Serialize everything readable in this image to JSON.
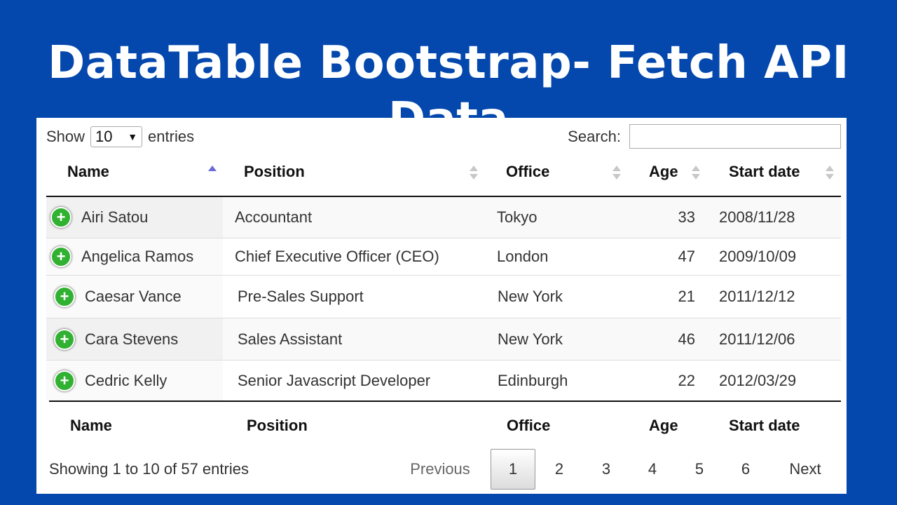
{
  "banner": {
    "title": "DataTable Bootstrap- Fetch API Data"
  },
  "controls": {
    "show_label": "Show",
    "entries_label": "entries",
    "page_length": "10",
    "search_label": "Search:",
    "search_value": ""
  },
  "table": {
    "columns": [
      "Name",
      "Position",
      "Office",
      "Age",
      "Start date"
    ],
    "sorted_column": "Name",
    "sort_direction": "ascending",
    "rows": [
      {
        "name": "Airi Satou",
        "position": "Accountant",
        "office": "Tokyo",
        "age": "33",
        "start_date": "2008/11/28"
      },
      {
        "name": "Angelica Ramos",
        "position": "Chief Executive Officer (CEO)",
        "office": "London",
        "age": "47",
        "start_date": "2009/10/09"
      },
      {
        "name": "Caesar Vance",
        "position": "Pre-Sales Support",
        "office": "New York",
        "age": "21",
        "start_date": "2011/12/12"
      },
      {
        "name": "Cara Stevens",
        "position": "Sales Assistant",
        "office": "New York",
        "age": "46",
        "start_date": "2011/12/06"
      },
      {
        "name": "Cedric Kelly",
        "position": "Senior Javascript Developer",
        "office": "Edinburgh",
        "age": "22",
        "start_date": "2012/03/29"
      }
    ],
    "expand_icon": "plus-circle-icon"
  },
  "footer": {
    "info": "Showing 1 to 10 of 57 entries",
    "previous": "Previous",
    "next": "Next",
    "pages": [
      "1",
      "2",
      "3",
      "4",
      "5",
      "6"
    ],
    "current_page": "1"
  },
  "colors": {
    "background": "#0448ad",
    "expand_button": "#31b131",
    "sort_active": "#6b6bd6",
    "sort_inactive": "#c8c8c8"
  }
}
